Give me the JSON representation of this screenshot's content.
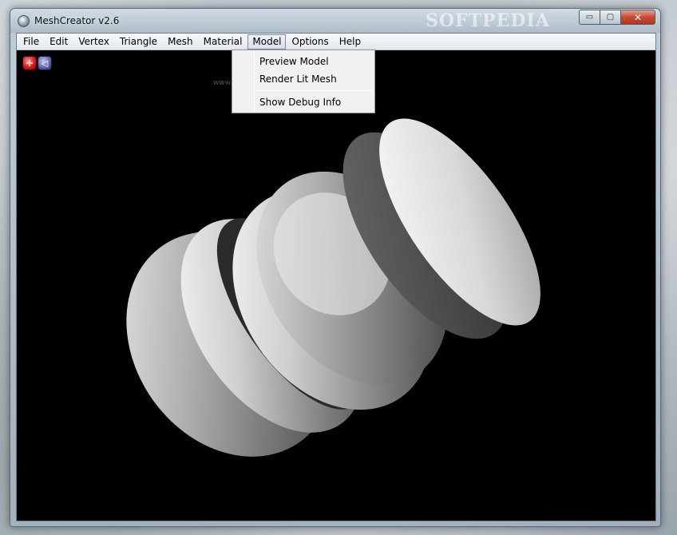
{
  "window": {
    "title": "MeshCreator v2.6",
    "watermark": "SOFTPEDIA",
    "buttons": {
      "minimize": "▭",
      "maximize": "▢",
      "close": "✕"
    }
  },
  "menubar": {
    "items": [
      "File",
      "Edit",
      "Vertex",
      "Triangle",
      "Mesh",
      "Material",
      "Model",
      "Options",
      "Help"
    ],
    "active_index": 6
  },
  "model_menu": {
    "items": [
      "Preview Model",
      "Render Lit Mesh",
      "Show Debug Info"
    ]
  },
  "toolbar": {
    "icons": [
      "move-tool-icon",
      "rotate-tool-icon"
    ]
  },
  "viewport": {
    "watermark_url": "www.softpedia.com",
    "background": "#000000"
  },
  "colors": {
    "accent_close": "#c74a35",
    "menu_bg": "#f1f1f1"
  }
}
